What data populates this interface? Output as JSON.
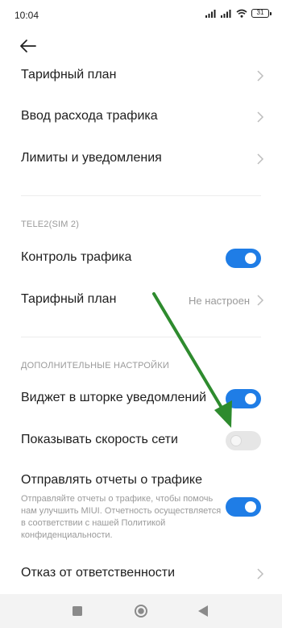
{
  "status_bar": {
    "time": "10:04",
    "battery": "31"
  },
  "items": {
    "tariff_plan_1": "Тарифный план",
    "traffic_input": "Ввод расхода трафика",
    "limits": "Лимиты и уведомления",
    "sim2_section": "TELE2(SIM 2)",
    "traffic_control": "Контроль трафика",
    "tariff_plan_2": "Тарифный план",
    "tariff_plan_2_value": "Не настроен",
    "extra_section": "ДОПОЛНИТЕЛЬНЫЕ НАСТРОЙКИ",
    "widget": "Виджет в шторке уведомлений",
    "show_speed": "Показывать скорость сети",
    "send_reports": "Отправлять отчеты о трафике",
    "send_reports_desc": "Отправляйте отчеты о трафике, чтобы помочь нам улучшить MIUI. Отчетность осуществляется в соответствии с нашей Политикой конфиденциальности.",
    "disclaimer": "Отказ от ответственности"
  },
  "toggles": {
    "traffic_control": true,
    "widget": true,
    "show_speed": false,
    "send_reports": true
  },
  "colors": {
    "accent": "#1f7de6",
    "annotation_arrow": "#2e8b2e"
  },
  "icons": {
    "back": "arrow-left-icon",
    "nav_recents": "square-icon",
    "nav_home": "circle-icon",
    "nav_back": "triangle-back-icon"
  }
}
